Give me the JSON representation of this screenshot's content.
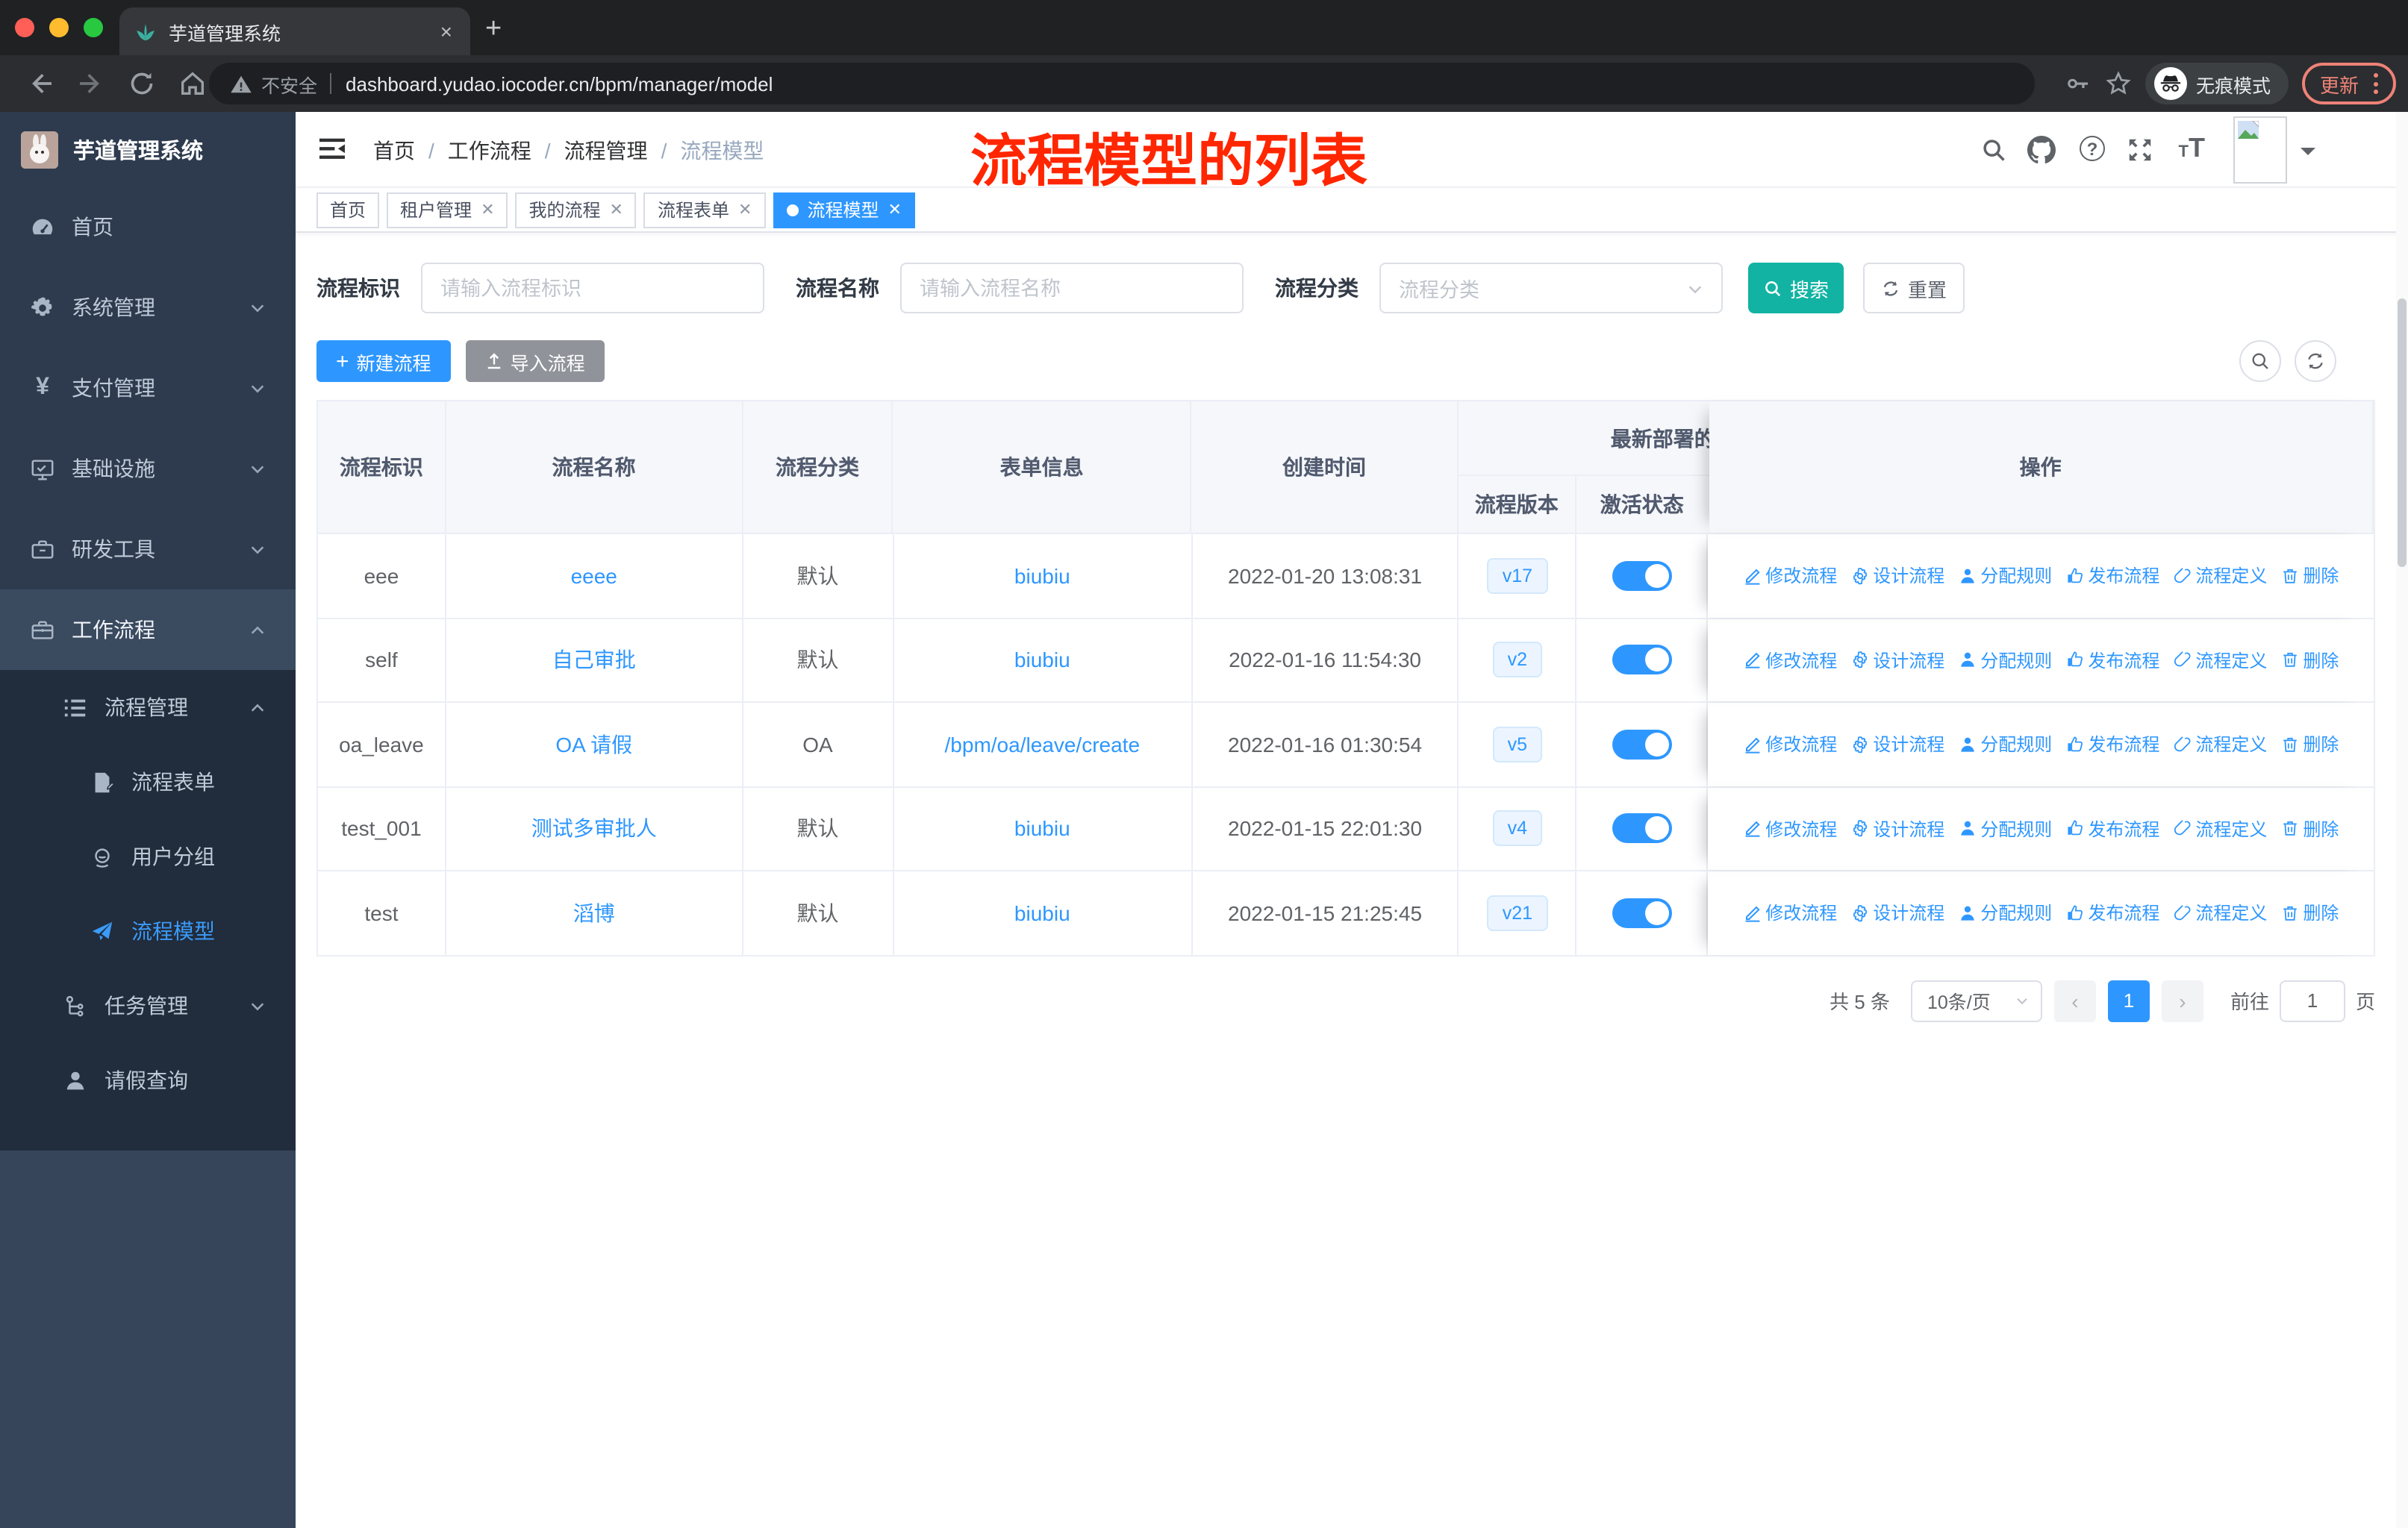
{
  "browser": {
    "tab_title": "芋道管理系统",
    "tab_close": "×",
    "new_tab": "+",
    "security_label": "不安全",
    "url": "dashboard.yudao.iocoder.cn/bpm/manager/model",
    "incognito_label": "无痕模式",
    "update_label": "更新"
  },
  "sidebar": {
    "app_title": "芋道管理系统",
    "items": [
      {
        "label": "首页",
        "icon": "dashboard-icon"
      },
      {
        "label": "系统管理",
        "icon": "gear-icon",
        "chevron": "down"
      },
      {
        "label": "支付管理",
        "icon": "yen-icon",
        "chevron": "down"
      },
      {
        "label": "基础设施",
        "icon": "monitor-icon",
        "chevron": "down"
      },
      {
        "label": "研发工具",
        "icon": "toolbox-icon",
        "chevron": "down"
      },
      {
        "label": "工作流程",
        "icon": "briefcase-icon",
        "chevron": "up",
        "active_parent": true
      }
    ],
    "submenu": [
      {
        "label": "流程管理",
        "icon": "list-icon",
        "chevron": "up"
      },
      {
        "label": "流程表单",
        "icon": "form-icon"
      },
      {
        "label": "用户分组",
        "icon": "users-icon"
      },
      {
        "label": "流程模型",
        "icon": "send-icon",
        "active": true
      },
      {
        "label": "任务管理",
        "icon": "tree-icon",
        "chevron": "down"
      },
      {
        "label": "请假查询",
        "icon": "user-icon"
      }
    ]
  },
  "header": {
    "breadcrumb": [
      "首页",
      "工作流程",
      "流程管理",
      "流程模型"
    ],
    "annotation": "流程模型的列表"
  },
  "tabs": [
    {
      "label": "首页",
      "closable": false,
      "active": false
    },
    {
      "label": "租户管理",
      "closable": true,
      "active": false
    },
    {
      "label": "我的流程",
      "closable": true,
      "active": false
    },
    {
      "label": "流程表单",
      "closable": true,
      "active": false
    },
    {
      "label": "流程模型",
      "closable": true,
      "active": true
    }
  ],
  "filters": {
    "id_label": "流程标识",
    "id_placeholder": "请输入流程标识",
    "name_label": "流程名称",
    "name_placeholder": "请输入流程名称",
    "category_label": "流程分类",
    "category_placeholder": "流程分类",
    "search_label": "搜索",
    "reset_label": "重置"
  },
  "toolbar": {
    "create_label": "新建流程",
    "import_label": "导入流程"
  },
  "table": {
    "columns": {
      "id": "流程标识",
      "name": "流程名称",
      "category": "流程分类",
      "form": "表单信息",
      "created": "创建时间",
      "group": "最新部署的",
      "version": "流程版本",
      "active": "激活状态",
      "actions": "操作"
    },
    "rows": [
      {
        "id": "eee",
        "name": "eeee",
        "category": "默认",
        "form": "biubiu",
        "created": "2022-01-20 13:08:31",
        "version": "v17",
        "active": true
      },
      {
        "id": "self",
        "name": "自己审批",
        "category": "默认",
        "form": "biubiu",
        "created": "2022-01-16 11:54:30",
        "version": "v2",
        "active": true
      },
      {
        "id": "oa_leave",
        "name": "OA 请假",
        "category": "OA",
        "form": "/bpm/oa/leave/create",
        "created": "2022-01-16 01:30:54",
        "version": "v5",
        "active": true
      },
      {
        "id": "test_001",
        "name": "测试多审批人",
        "category": "默认",
        "form": "biubiu",
        "created": "2022-01-15 22:01:30",
        "version": "v4",
        "active": true
      },
      {
        "id": "test",
        "name": "滔博",
        "category": "默认",
        "form": "biubiu",
        "created": "2022-01-15 21:25:45",
        "version": "v21",
        "active": true
      }
    ],
    "actions": [
      {
        "label": "修改流程",
        "icon": "pencil-icon"
      },
      {
        "label": "设计流程",
        "icon": "gear-icon"
      },
      {
        "label": "分配规则",
        "icon": "user-icon"
      },
      {
        "label": "发布流程",
        "icon": "hand-icon"
      },
      {
        "label": "流程定义",
        "icon": "paperclip-icon"
      },
      {
        "label": "删除",
        "icon": "trash-icon"
      }
    ]
  },
  "pagination": {
    "total": "共 5 条",
    "page_size": "10条/页",
    "page": "1",
    "prev": "‹",
    "next": "›",
    "goto_label": "前往",
    "goto_value": "1",
    "page_suffix": "页"
  },
  "colors": {
    "primary": "#2e97ff",
    "search_teal": "#12b3a3",
    "annotation_red": "#ff2600"
  }
}
